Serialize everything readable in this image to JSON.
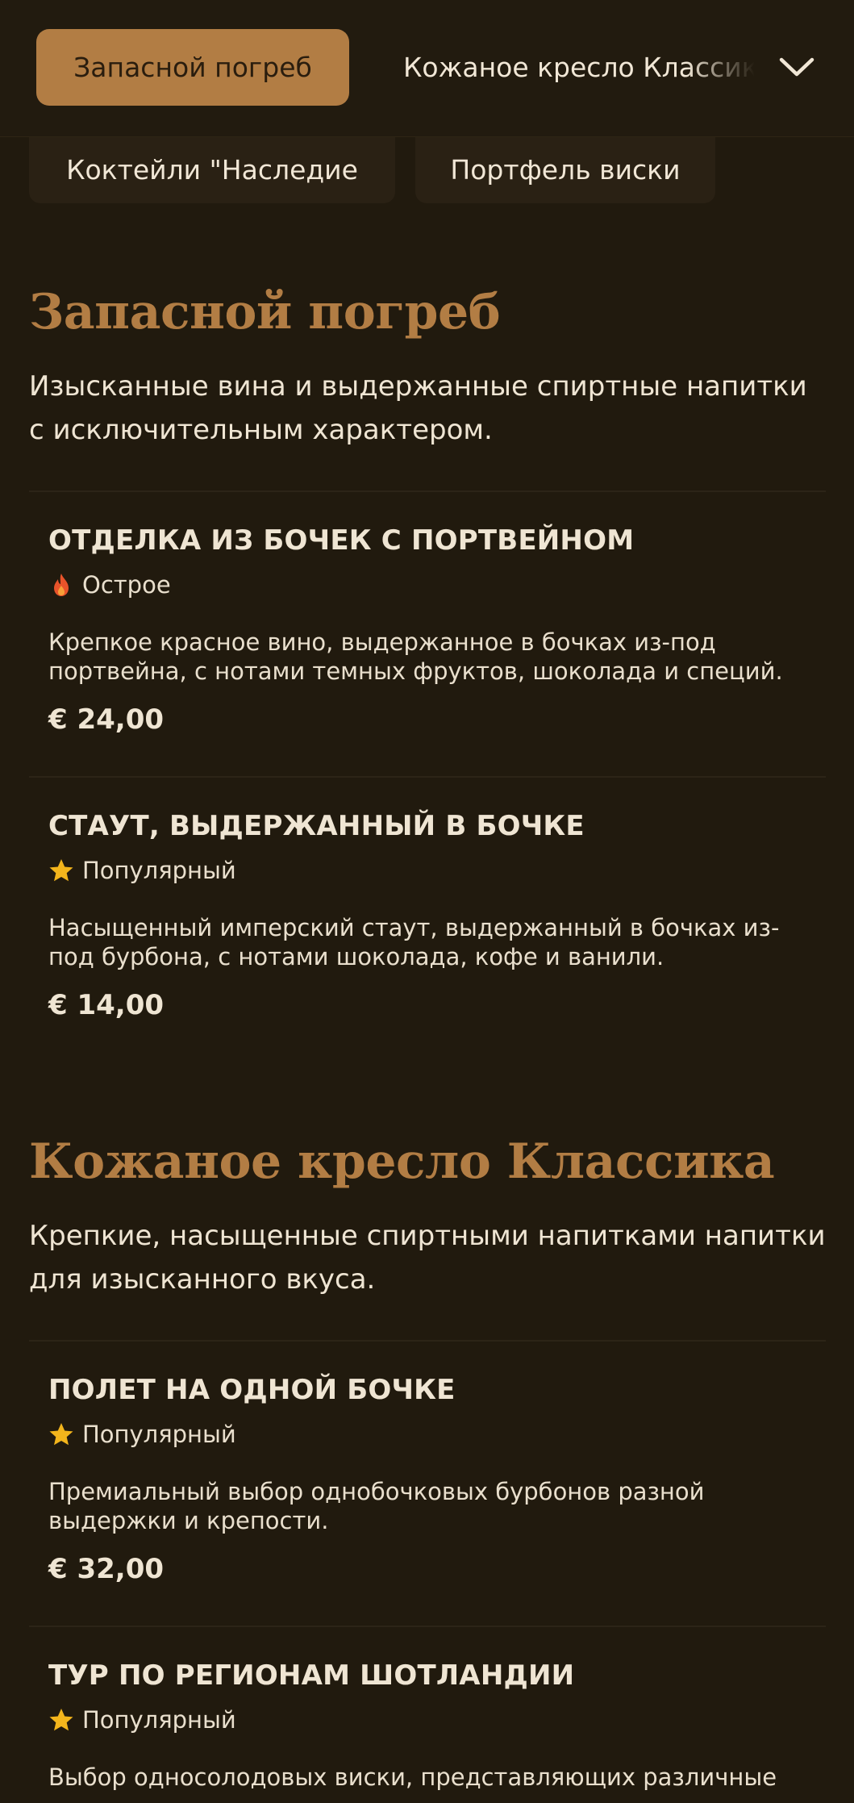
{
  "nav": {
    "active_tab": "Запасной погреб",
    "next_tab": "Кожаное кресло Классика",
    "row2_tabs": [
      "Коктейли \"Наследие",
      "Портфель виски"
    ]
  },
  "sections": [
    {
      "title": "Запасной погреб",
      "description": "Изысканные вина и выдержанные спиртные напитки с исключительным характером.",
      "items": [
        {
          "name": "ОТДЕЛКА ИЗ БОЧЕК С ПОРТВЕЙНОМ",
          "tag": "Острое",
          "tag_icon": "flame-icon",
          "description": "Крепкое красное вино, выдержанное в бочках из-под портвейна, с нотами темных фруктов, шоколада и специй.",
          "price": "€ 24,00"
        },
        {
          "name": "СТАУТ, ВЫДЕРЖАННЫЙ В БОЧКЕ",
          "tag": "Популярный",
          "tag_icon": "star-icon",
          "description": "Насыщенный имперский стаут, выдержанный в бочках из-под бурбона, с нотами шоколада, кофе и ванили.",
          "price": "€ 14,00"
        }
      ]
    },
    {
      "title": "Кожаное кресло Классика",
      "description": "Крепкие, насыщенные спиртными напитками напитки для изысканного вкуса.",
      "items": [
        {
          "name": "ПОЛЕТ НА ОДНОЙ БОЧКЕ",
          "tag": "Популярный",
          "tag_icon": "star-icon",
          "description": "Премиальный выбор однобочковых бурбонов разной выдержки и крепости.",
          "price": "€ 32,00"
        },
        {
          "name": "ТУР ПО РЕГИОНАМ ШОТЛАНДИИ",
          "tag": "Популярный",
          "tag_icon": "star-icon",
          "description": "Выбор односолодовых виски, представляющих различные"
        }
      ]
    }
  ],
  "colors": {
    "background": "#211a0e",
    "accent": "#b27d44",
    "star": "#f3b51c",
    "flame": "#e8532a"
  }
}
